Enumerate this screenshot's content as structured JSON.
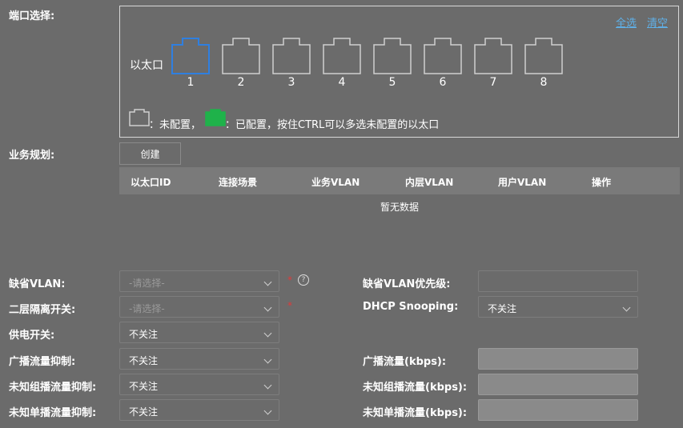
{
  "port_section": {
    "label": "端口选择:",
    "select_all": "全选",
    "clear": "清空",
    "eth_label": "以太口",
    "ports": [
      "1",
      "2",
      "3",
      "4",
      "5",
      "6",
      "7",
      "8"
    ],
    "selected_port": "1",
    "legend_unconfigured": "：未配置，",
    "legend_configured": "：已配置，按住CTRL可以多选未配置的以太口",
    "colors": {
      "selected": "#2f7fe0",
      "unconfigured": "#d0d0d0",
      "configured": "#1fb24a",
      "link": "#5fb0e8"
    }
  },
  "service": {
    "label": "业务规划:",
    "create_button": "创建",
    "columns": [
      "以太口ID",
      "连接场景",
      "业务VLAN",
      "内层VLAN",
      "用户VLAN",
      "操作"
    ],
    "rows": [],
    "empty_text": "暂无数据"
  },
  "form": {
    "default_vlan": {
      "label": "缺省VLAN:",
      "placeholder": "-请选择-",
      "required": "*",
      "help": "?"
    },
    "default_vlan_priority": {
      "label": "缺省VLAN优先级:",
      "value": ""
    },
    "l2_isolation": {
      "label": "二层隔离开关:",
      "placeholder": "-请选择-",
      "required": "*"
    },
    "dhcp_snooping": {
      "label": "DHCP Snooping:",
      "value": "不关注"
    },
    "power_switch": {
      "label": "供电开关:",
      "value": "不关注"
    },
    "broadcast_suppress": {
      "label": "广播流量抑制:",
      "value": "不关注"
    },
    "broadcast_rate": {
      "label": "广播流量(kbps):",
      "value": ""
    },
    "unknown_multicast_suppress": {
      "label": "未知组播流量抑制:",
      "value": "不关注"
    },
    "unknown_multicast_rate": {
      "label": "未知组播流量(kbps):",
      "value": ""
    },
    "unknown_unicast_suppress": {
      "label": "未知单播流量抑制:",
      "value": "不关注"
    },
    "unknown_unicast_rate": {
      "label": "未知单播流量(kbps):",
      "value": ""
    }
  }
}
